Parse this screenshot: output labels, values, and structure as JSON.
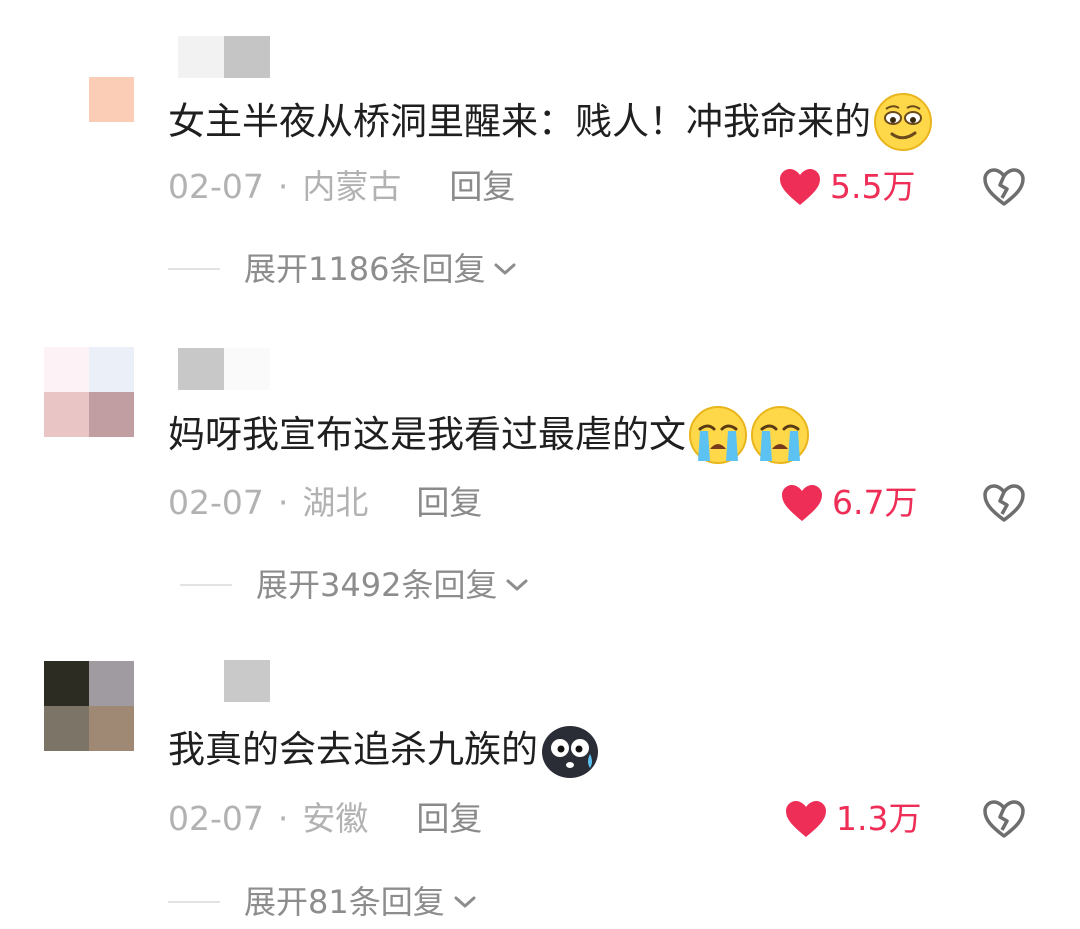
{
  "comments": [
    {
      "text": "女主半夜从桥洞里醒来：贱人！冲我命来的",
      "emoji": "smirk-emoji",
      "date": "02-07",
      "separator": "·",
      "location": "内蒙古",
      "reply_label": "回复",
      "likes": "5.5万",
      "expand_label": "展开1186条回复"
    },
    {
      "text": "妈呀我宣布这是我看过最虐的文",
      "emoji": "crying-emoji",
      "date": "02-07",
      "separator": "·",
      "location": "湖北",
      "reply_label": "回复",
      "likes": "6.7万",
      "expand_label": "展开3492条回复"
    },
    {
      "text": "我真的会去追杀九族的",
      "emoji": "scared-black-emoji",
      "date": "02-07",
      "separator": "·",
      "location": "安徽",
      "reply_label": "回复",
      "likes": "1.3万",
      "expand_label": "展开81条回复"
    }
  ],
  "icons": {
    "like": "heart-icon",
    "dislike": "broken-heart-icon",
    "expand": "chevron-down-icon"
  },
  "colors": {
    "like_red": "#ee2e56",
    "meta_gray": "#b2b2b2",
    "text": "#1f1f1f"
  }
}
